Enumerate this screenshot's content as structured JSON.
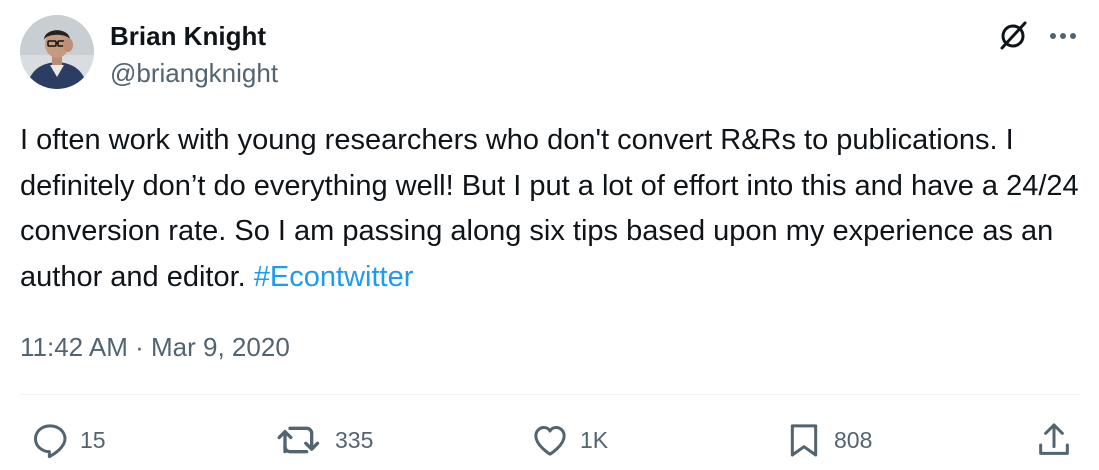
{
  "author": {
    "name": "Brian Knight",
    "handle": "@briangknight"
  },
  "tweet": {
    "text": "I often work with young researchers who don't convert R&Rs to publications. I definitely don’t do everything well! But I put a lot of effort into this and have a 24/24 conversion rate. So I am passing along six tips based upon my experience as an author and editor. ",
    "hashtag": "#Econtwitter",
    "timestamp": "11:42 AM · Mar 9, 2020"
  },
  "actions": {
    "replies": "15",
    "reposts": "335",
    "likes": "1K",
    "bookmarks": "808"
  },
  "icons": {
    "header": [
      "grok-icon",
      "more-icon"
    ],
    "footer": [
      "reply-icon",
      "repost-icon",
      "like-icon",
      "bookmark-icon",
      "share-icon"
    ]
  },
  "colors": {
    "text": "#0f1419",
    "secondary": "#536471",
    "link": "#1d9bf0",
    "divider": "#eff3f4"
  }
}
